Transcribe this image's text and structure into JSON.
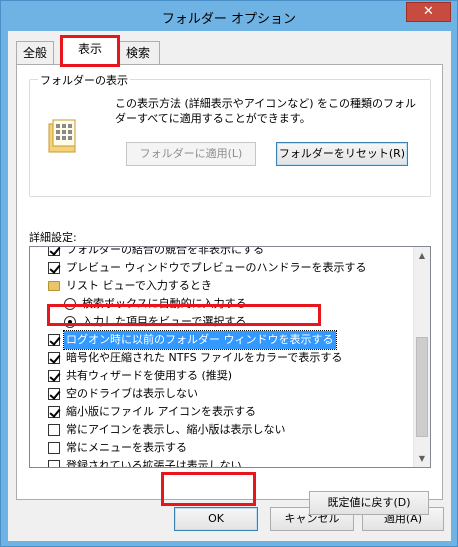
{
  "window": {
    "title": "フォルダー オプション",
    "close_label": "✕"
  },
  "tabs": [
    {
      "label": "全般"
    },
    {
      "label": "表示"
    },
    {
      "label": "検索"
    }
  ],
  "folder_view": {
    "group_label": "フォルダーの表示",
    "description": "この表示方法 (詳細表示やアイコンなど) をこの種類のフォルダーすべてに適用することができます。",
    "apply_button": "フォルダーに適用(L)",
    "reset_button": "フォルダーをリセット(R)"
  },
  "advanced": {
    "label": "詳細設定:",
    "items": [
      {
        "type": "checkbox",
        "checked": true,
        "label": "フォルダーの結合の競合を非表示にする"
      },
      {
        "type": "checkbox",
        "checked": true,
        "label": "プレビュー ウィンドウでプレビューのハンドラーを表示する"
      },
      {
        "type": "folder",
        "label": "リスト ビューで入力するとき"
      },
      {
        "type": "radio",
        "selected": false,
        "label": "検索ボックスに自動的に入力する"
      },
      {
        "type": "radio",
        "selected": true,
        "label": "入力した項目をビューで選択する"
      },
      {
        "type": "checkbox",
        "checked": true,
        "label": "ログオン時に以前のフォルダー ウィンドウを表示する",
        "highlight": true
      },
      {
        "type": "checkbox",
        "checked": true,
        "label": "暗号化や圧縮された NTFS ファイルをカラーで表示する"
      },
      {
        "type": "checkbox",
        "checked": true,
        "label": "共有ウィザードを使用する (推奨)"
      },
      {
        "type": "checkbox",
        "checked": true,
        "label": "空のドライブは表示しない"
      },
      {
        "type": "checkbox",
        "checked": true,
        "label": "縮小版にファイル アイコンを表示する"
      },
      {
        "type": "checkbox",
        "checked": false,
        "label": "常にアイコンを表示し、縮小版は表示しない"
      },
      {
        "type": "checkbox",
        "checked": false,
        "label": "常にメニューを表示する"
      },
      {
        "type": "checkbox",
        "checked": false,
        "label": "登録されている拡張子は表示しない"
      }
    ],
    "restore_button": "既定値に戻す(D)"
  },
  "footer": {
    "ok": "OK",
    "cancel": "キャンセル",
    "apply": "適用(A)"
  }
}
